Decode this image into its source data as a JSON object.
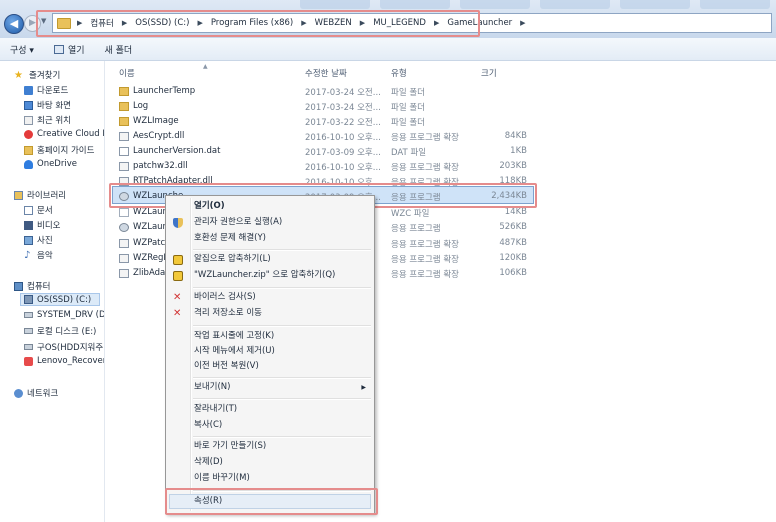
{
  "address": {
    "crumbs": [
      "컴퓨터",
      "OS(SSD) (C:)",
      "Program Files (x86)",
      "WEBZEN",
      "MU_LEGEND",
      "GameLauncher"
    ]
  },
  "toolbar": {
    "organize": "구성 ▾",
    "open": "열기",
    "new_folder": "새 폴더"
  },
  "nav": {
    "favorites": "즐겨찾기",
    "downloads": "다운로드",
    "desktop": "바탕 화면",
    "recent": "최근 위치",
    "creative_cloud": "Creative Cloud Fi",
    "homepage": "홈페이지 가이드",
    "onedrive": "OneDrive",
    "libraries": "라이브러리",
    "documents": "문서",
    "videos": "비디오",
    "pictures": "사진",
    "music": "음악",
    "computer": "컴퓨터",
    "drive_os": "OS(SSD) (C:)",
    "drive_system": "SYSTEM_DRV (D",
    "drive_local": "로컬 디스크 (E:)",
    "drive_old": "구OS(HDD지워주",
    "drive_lenovo": "Lenovo_Recovery",
    "network": "네트워크"
  },
  "columns": {
    "name": "이름",
    "date": "수정한 날짜",
    "type": "유형",
    "size": "크기"
  },
  "files": [
    {
      "name": "LauncherTemp",
      "date": "2017-03-24 오전...",
      "type": "파일 폴더",
      "size": ""
    },
    {
      "name": "Log",
      "date": "2017-03-24 오전...",
      "type": "파일 폴더",
      "size": ""
    },
    {
      "name": "WZLImage",
      "date": "2017-03-22 오전...",
      "type": "파일 폴더",
      "size": ""
    },
    {
      "name": "AesCrypt.dll",
      "date": "2016-10-10 오후...",
      "type": "응용 프로그램 확장",
      "size": "84KB"
    },
    {
      "name": "LauncherVersion.dat",
      "date": "2017-03-09 오후...",
      "type": "DAT 파일",
      "size": "1KB"
    },
    {
      "name": "patchw32.dll",
      "date": "2016-10-10 오후...",
      "type": "응용 프로그램 확장",
      "size": "203KB"
    },
    {
      "name": "RTPatchAdapter.dll",
      "date": "2016-10-10 오후...",
      "type": "응용 프로그램 확장",
      "size": "118KB"
    },
    {
      "name": "WZLaunche",
      "date": "2017-03-09 오후...",
      "type": "응용 프로그램",
      "size": "2,434KB"
    },
    {
      "name": "WZLaunch",
      "date": "",
      "type": "WZC 파일",
      "size": "14KB"
    },
    {
      "name": "WZLaunch",
      "date": "",
      "type": "응용 프로그램",
      "size": "526KB"
    },
    {
      "name": "WZPatcha",
      "date": "",
      "type": "응용 프로그램 확장",
      "size": "487KB"
    },
    {
      "name": "WZRegPII",
      "date": "",
      "type": "응용 프로그램 확장",
      "size": "120KB"
    },
    {
      "name": "ZlibAdapt",
      "date": "",
      "type": "응용 프로그램 확장",
      "size": "106KB"
    }
  ],
  "menu": {
    "open": "열기(O)",
    "run_as_admin": "관리자 권한으로 실행(A)",
    "compat": "호환성 문제 해결(Y)",
    "compress": "알집으로 압축하기(L)",
    "compress_zip": "\"WZLauncher.zip\" 으로 압축하기(Q)",
    "virus_scan": "바이러스 검사(S)",
    "quarantine": "격리 저장소로 이동",
    "pin_taskbar": "작업 표시줄에 고정(K)",
    "unpin_start": "시작 메뉴에서 제거(U)",
    "restore": "이전 버전 복원(V)",
    "send_to": "보내기(N)",
    "cut": "잘라내기(T)",
    "copy": "복사(C)",
    "shortcut": "바로 가기 만들기(S)",
    "delete": "삭제(D)",
    "rename": "이름 바꾸기(M)",
    "properties": "속성(R)"
  }
}
